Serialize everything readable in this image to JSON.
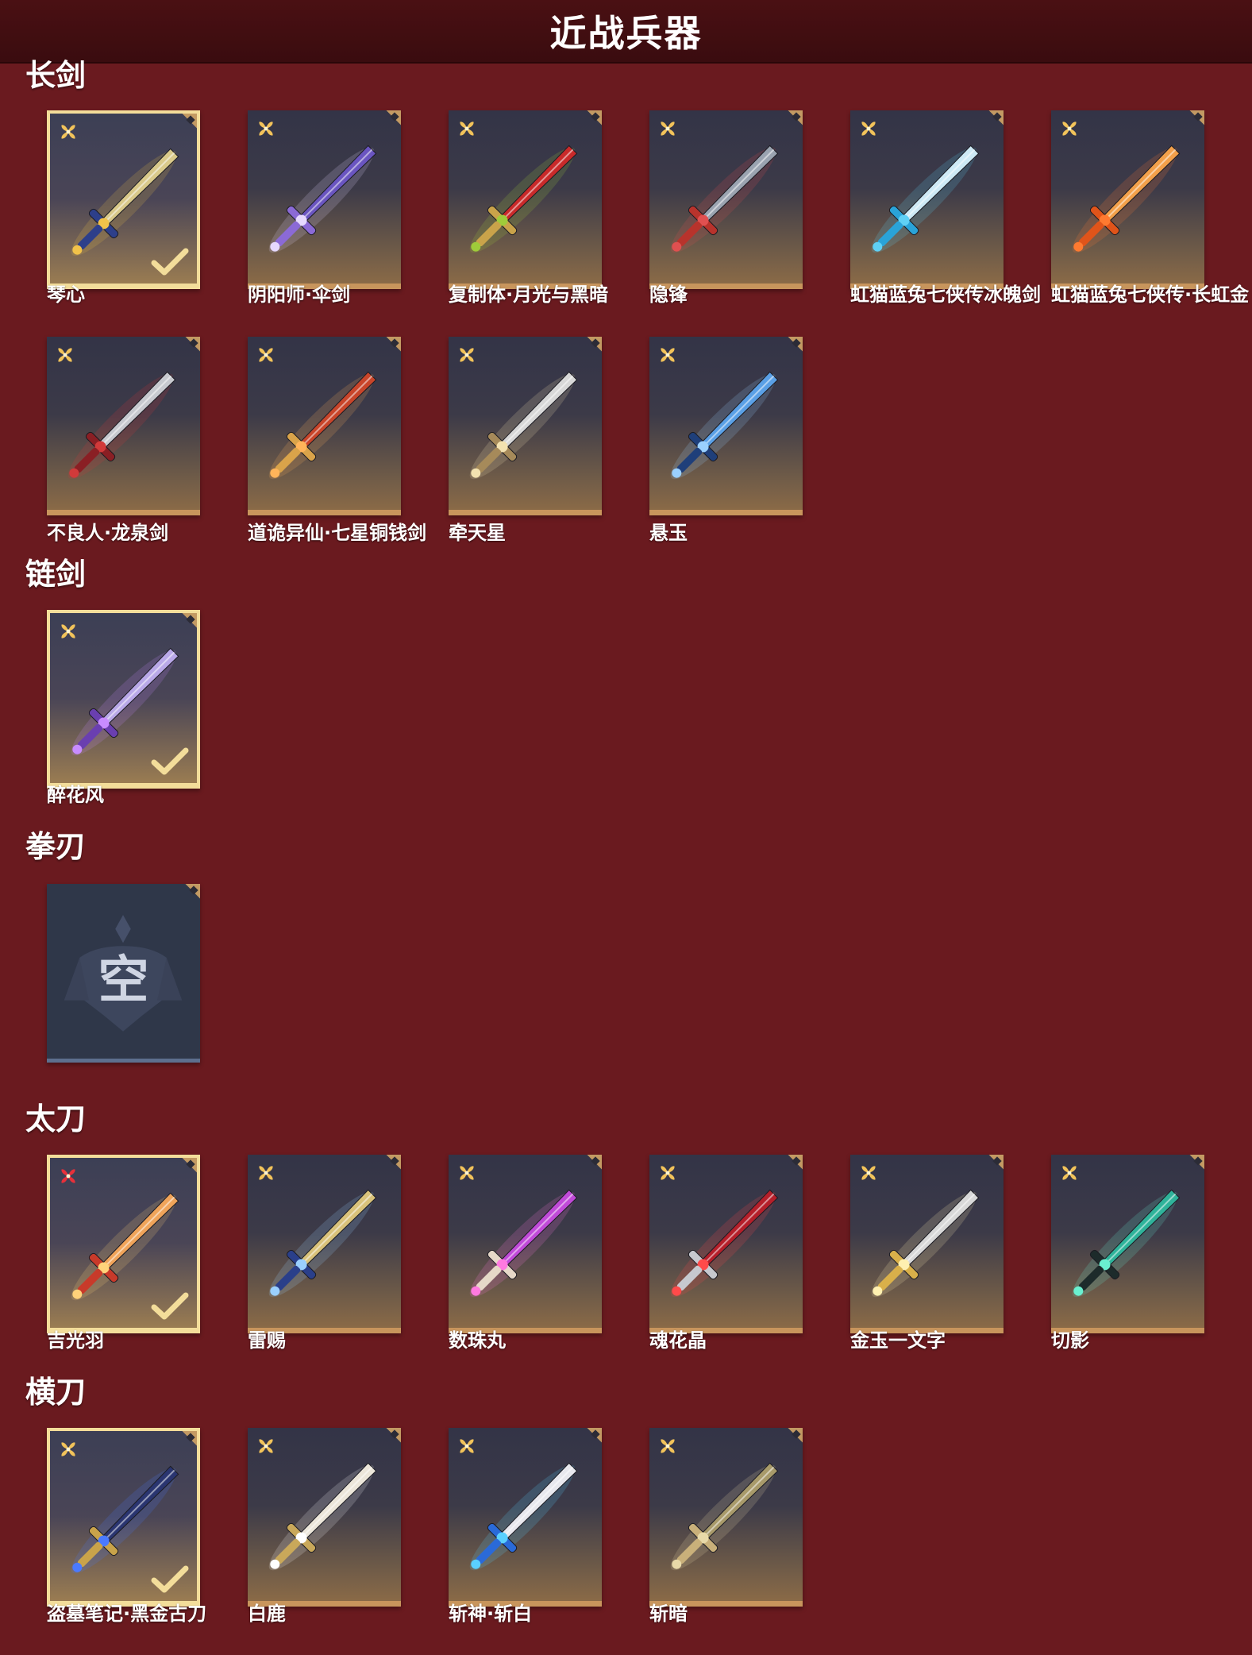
{
  "header": {
    "title": "近战兵器"
  },
  "sections": [
    {
      "title": "长剑",
      "items": [
        {
          "name": "琴心",
          "selected": true,
          "rank": "gold",
          "blade": "#d9c98a",
          "hilt": "#2d3f8a",
          "accent": "#f1c24a"
        },
        {
          "name": "阴阳师·伞剑",
          "selected": false,
          "rank": "gold",
          "blade": "#6a55c0",
          "hilt": "#8b6ad6",
          "accent": "#e6d9ff"
        },
        {
          "name": "复制体·月光与黑暗",
          "selected": false,
          "rank": "gold",
          "blade": "#c92a2a",
          "hilt": "#c9a34a",
          "accent": "#9fcc3a"
        },
        {
          "name": "隐锋",
          "selected": false,
          "rank": "gold",
          "blade": "#9aa3b0",
          "hilt": "#b8332c",
          "accent": "#e05050"
        },
        {
          "name": "虹猫蓝兔七侠传冰魄剑",
          "selected": false,
          "rank": "gold",
          "blade": "#cde9f5",
          "hilt": "#2aa3d8",
          "accent": "#5fd0f5"
        },
        {
          "name": "虹猫蓝兔七侠传·长虹金",
          "selected": false,
          "rank": "gold",
          "blade": "#f3a04a",
          "hilt": "#e0541a",
          "accent": "#ff7a30"
        }
      ]
    },
    {
      "title": "",
      "items": [
        {
          "name": "不良人·龙泉剑",
          "selected": false,
          "rank": "gold",
          "blade": "#c7c9cf",
          "hilt": "#8a1f24",
          "accent": "#d13a3a"
        },
        {
          "name": "道诡异仙·七星铜钱剑",
          "selected": false,
          "rank": "gold",
          "blade": "#c8452a",
          "hilt": "#d9a34a",
          "accent": "#ffb45a"
        },
        {
          "name": "牵天星",
          "selected": false,
          "rank": "gold",
          "blade": "#d8d8d8",
          "hilt": "#a68a5a",
          "accent": "#f3e2b0"
        },
        {
          "name": "悬玉",
          "selected": false,
          "rank": "gold",
          "blade": "#5aa0e6",
          "hilt": "#1f3f7a",
          "accent": "#9ad0ff"
        }
      ]
    },
    {
      "title": "链剑",
      "items": [
        {
          "name": "醉花风",
          "selected": true,
          "rank": "gold",
          "blade": "#b9a8e8",
          "hilt": "#6a3fb0",
          "accent": "#c88cff"
        }
      ]
    },
    {
      "title": "拳刃",
      "items": [
        {
          "name": "",
          "empty": true,
          "empty_char": "空"
        }
      ]
    },
    {
      "title": "太刀",
      "items": [
        {
          "name": "吉光羽",
          "selected": true,
          "rank": "red",
          "blade": "#f0a45a",
          "hilt": "#c83a2a",
          "accent": "#ffd27a"
        },
        {
          "name": "雷赐",
          "selected": false,
          "rank": "gold",
          "blade": "#d9c27a",
          "hilt": "#2a3f8a",
          "accent": "#9ad0ff"
        },
        {
          "name": "数珠丸",
          "selected": false,
          "rank": "gold",
          "blade": "#c04ad8",
          "hilt": "#e6d8c8",
          "accent": "#ff7ae0"
        },
        {
          "name": "魂花晶",
          "selected": false,
          "rank": "gold",
          "blade": "#b51f2a",
          "hilt": "#c7c9cf",
          "accent": "#ff4a4a"
        },
        {
          "name": "金玉一文字",
          "selected": false,
          "rank": "gold",
          "blade": "#d8d8d8",
          "hilt": "#d9b04a",
          "accent": "#fff0b0"
        },
        {
          "name": "切影",
          "selected": false,
          "rank": "gold",
          "blade": "#2fb39a",
          "hilt": "#1d2b2b",
          "accent": "#6af0d0"
        }
      ]
    },
    {
      "title": "横刀",
      "items": [
        {
          "name": "盗墓笔记·黑金古刀",
          "selected": true,
          "rank": "gold",
          "blade": "#2a3570",
          "hilt": "#c9a34a",
          "accent": "#4a7aff"
        },
        {
          "name": "白鹿",
          "selected": false,
          "rank": "gold",
          "blade": "#ece6da",
          "hilt": "#c9a85a",
          "accent": "#ffffff"
        },
        {
          "name": "斩神·斩白",
          "selected": false,
          "rank": "gold",
          "blade": "#e8e8ee",
          "hilt": "#2a6ad8",
          "accent": "#5ad0ff"
        },
        {
          "name": "斩暗",
          "selected": false,
          "rank": "gold",
          "blade": "#a89a6a",
          "hilt": "#c9b07a",
          "accent": "#e8d9a8"
        }
      ]
    }
  ]
}
